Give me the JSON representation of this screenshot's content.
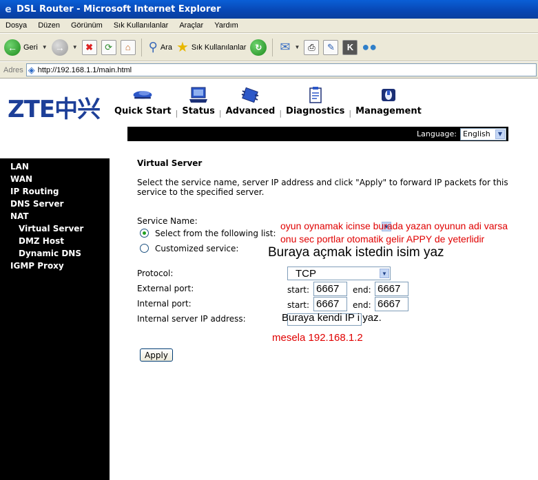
{
  "window": {
    "title": "DSL Router - Microsoft Internet Explorer"
  },
  "menu": [
    "Dosya",
    "Düzen",
    "Görünüm",
    "Sık Kullanılanlar",
    "Araçlar",
    "Yardım"
  ],
  "toolbar": {
    "back_label": "Geri",
    "search_label": "Ara",
    "favorites_label": "Sık Kullanılanlar"
  },
  "address": {
    "label": "Adres",
    "url": "http://192.168.1.1/main.html"
  },
  "logo": {
    "latin": "ZTE",
    "cjk": "中兴"
  },
  "nav": [
    "Quick Start",
    "Status",
    "Advanced",
    "Diagnostics",
    "Management"
  ],
  "language": {
    "label": "Language:",
    "value": "English"
  },
  "sidebar": [
    {
      "label": "LAN",
      "sub": false
    },
    {
      "label": "WAN",
      "sub": false
    },
    {
      "label": "IP Routing",
      "sub": false
    },
    {
      "label": "DNS Server",
      "sub": false
    },
    {
      "label": "NAT",
      "sub": false
    },
    {
      "label": "Virtual Server",
      "sub": true
    },
    {
      "label": "DMZ Host",
      "sub": true
    },
    {
      "label": "Dynamic DNS",
      "sub": true
    },
    {
      "label": "IGMP Proxy",
      "sub": false
    }
  ],
  "content": {
    "title": "Virtual Server",
    "description": "Select the service name, server IP address and click \"Apply\" to forward IP packets for this service to the specified server.",
    "service_name_label": "Service Name:",
    "option_select": "Select from the following list:",
    "option_custom": "Customized service:",
    "protocol_label": "Protocol:",
    "protocol_value": "TCP",
    "external_port_label": "External port:",
    "internal_port_label": "Internal port:",
    "server_ip_label": "Internal server IP address:",
    "start_label": "start:",
    "end_label": "end:",
    "ext_start": "6667",
    "ext_end": "6667",
    "int_start": "6667",
    "int_end": "6667",
    "apply_label": "Apply"
  },
  "annotations": {
    "red_line1": "oyun oynamak icinse burada yazan oyunun adi varsa",
    "red_line2": "onu sec portlar otomatik gelir APPY de yeterlidir",
    "black_custom": "Buraya açmak istedin isim yaz",
    "black_ip": "Buraya kendi IP i yaz.",
    "red_example": "mesela 192.168.1.2"
  },
  "colors": {
    "titlebar": "#0a5fd6",
    "chrome": "#ece9d8",
    "annotation_red": "#e00000",
    "logo_blue": "#1d3f98"
  }
}
